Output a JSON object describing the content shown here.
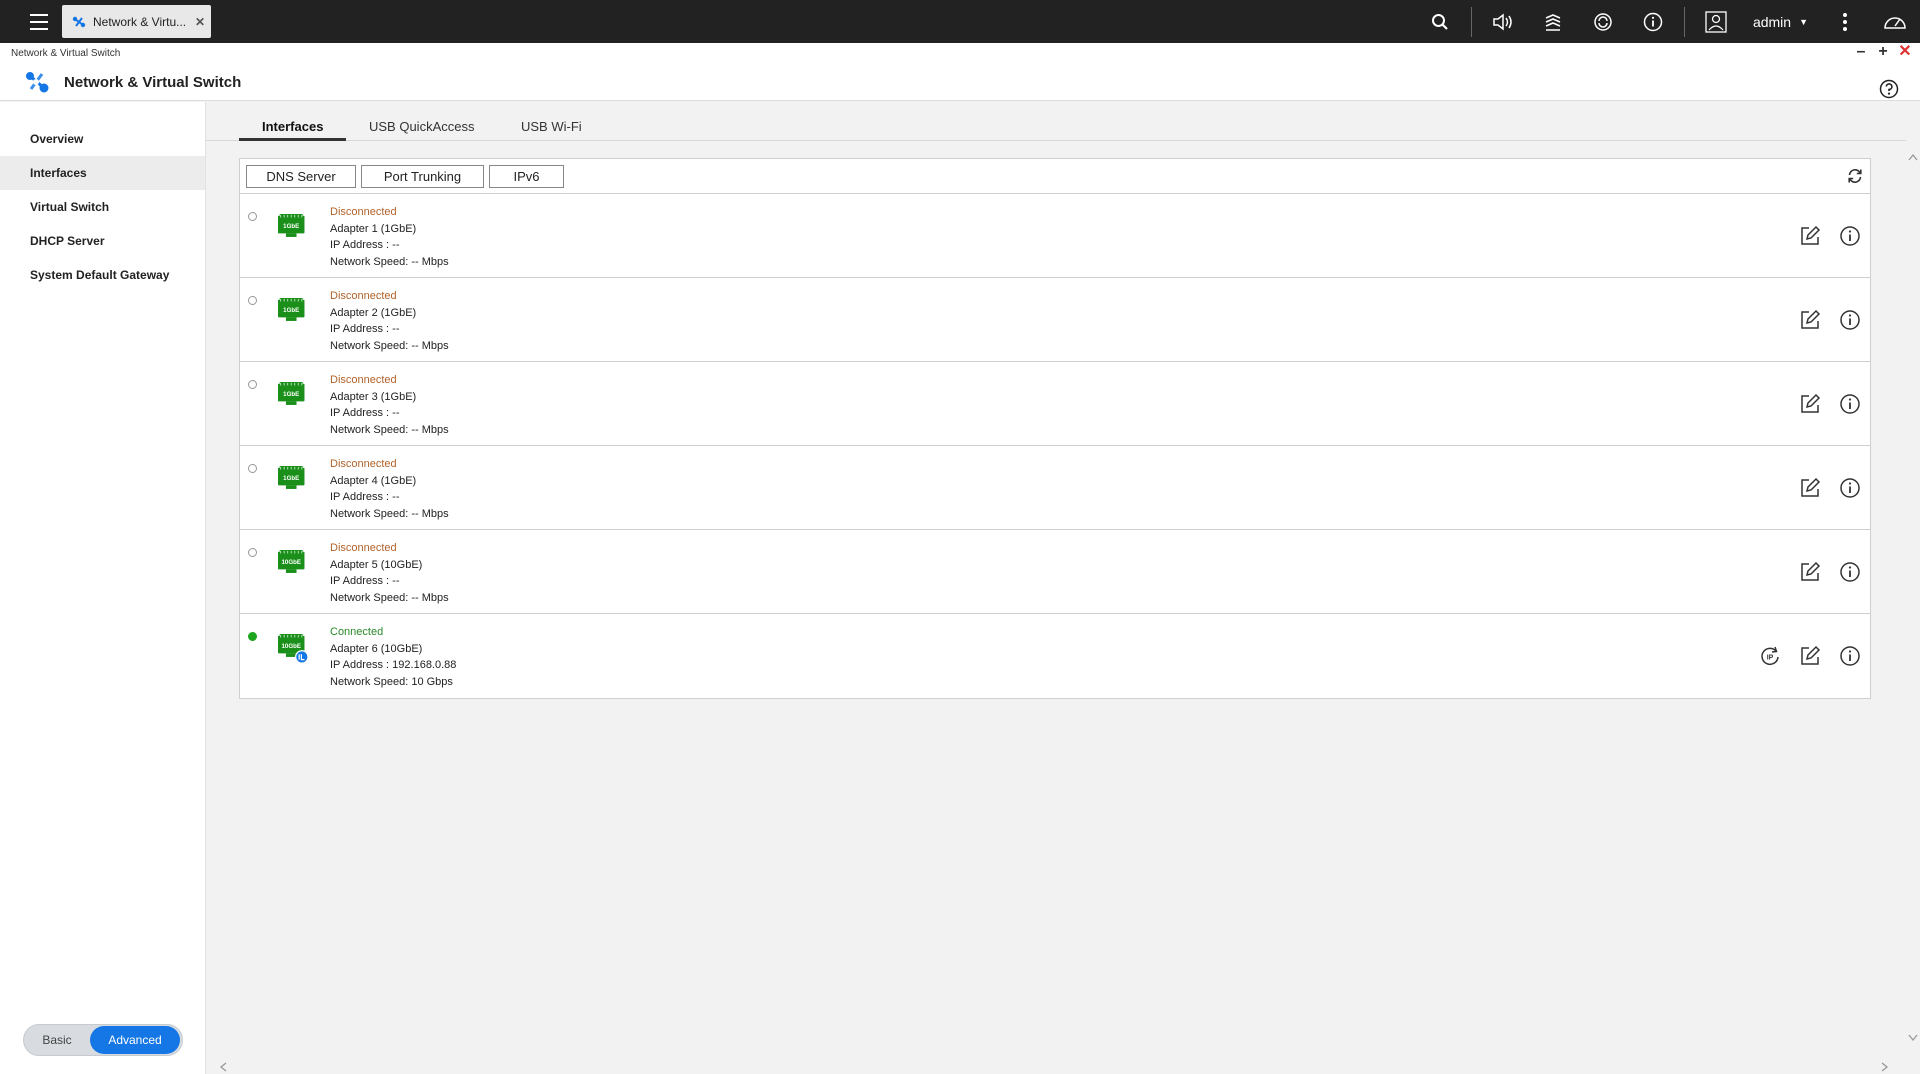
{
  "topbar": {
    "tab_label": "Network & Virtu...",
    "user": "admin",
    "icons": [
      "menu-icon",
      "search-icon",
      "volume-icon",
      "task-stack-icon",
      "sync-icon",
      "info-icon",
      "user-icon",
      "more-icon",
      "dashboard-icon"
    ]
  },
  "window": {
    "title": "Network & Virtual Switch",
    "app_name": "Network & Virtual Switch"
  },
  "sidebar": {
    "items": [
      {
        "label": "Overview"
      },
      {
        "label": "Interfaces"
      },
      {
        "label": "Virtual Switch"
      },
      {
        "label": "DHCP Server"
      },
      {
        "label": "System Default Gateway"
      }
    ],
    "active": "Interfaces",
    "mode": {
      "basic": "Basic",
      "advanced": "Advanced",
      "selected": "Advanced"
    }
  },
  "tabs": [
    "Interfaces",
    "USB QuickAccess",
    "USB Wi-Fi"
  ],
  "toolbar": {
    "dns": "DNS Server",
    "trunking": "Port Trunking",
    "ipv6": "IPv6"
  },
  "colors": {
    "accent": "#1576e5",
    "nic_green": "#1a8f1a",
    "disconnected": "#b0622a",
    "connected": "#2a8a2a"
  },
  "adapters": [
    {
      "status": "Disconnected",
      "name": "Adapter 1 (1GbE)",
      "ip_label": "IP Address :",
      "ip": "--",
      "speed_label": "Network Speed:",
      "speed": "-- Mbps",
      "nic_label": "1GbE"
    },
    {
      "status": "Disconnected",
      "name": "Adapter 2 (1GbE)",
      "ip_label": "IP Address :",
      "ip": "--",
      "speed_label": "Network Speed:",
      "speed": "-- Mbps",
      "nic_label": "1GbE"
    },
    {
      "status": "Disconnected",
      "name": "Adapter 3 (1GbE)",
      "ip_label": "IP Address :",
      "ip": "--",
      "speed_label": "Network Speed:",
      "speed": "-- Mbps",
      "nic_label": "1GbE"
    },
    {
      "status": "Disconnected",
      "name": "Adapter 4 (1GbE)",
      "ip_label": "IP Address :",
      "ip": "--",
      "speed_label": "Network Speed:",
      "speed": "-- Mbps",
      "nic_label": "1GbE"
    },
    {
      "status": "Disconnected",
      "name": "Adapter 5 (10GbE)",
      "ip_label": "IP Address :",
      "ip": "--",
      "speed_label": "Network Speed:",
      "speed": "-- Mbps",
      "nic_label": "10GbE"
    },
    {
      "status": "Connected",
      "name": "Adapter 6 (10GbE)",
      "ip_label": "IP Address :",
      "ip": "192.168.0.88",
      "speed_label": "Network Speed:",
      "speed": "10 Gbps",
      "nic_label": "10GbE"
    }
  ]
}
